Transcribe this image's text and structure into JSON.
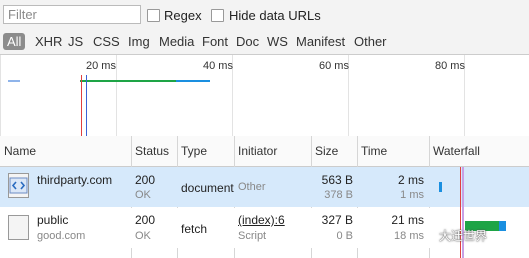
{
  "filterbar": {
    "filter_placeholder": "Filter",
    "regex_label": "Regex",
    "hide_data_urls_label": "Hide data URLs"
  },
  "type_filters": [
    "All",
    "XHR",
    "JS",
    "CSS",
    "Img",
    "Media",
    "Font",
    "Doc",
    "WS",
    "Manifest",
    "Other"
  ],
  "selected_type_filter": "All",
  "overview": {
    "ticks": [
      "20 ms",
      "40 ms",
      "60 ms",
      "80 ms"
    ]
  },
  "columns": [
    "Name",
    "Status",
    "Type",
    "Initiator",
    "Size",
    "Time",
    "Waterfall"
  ],
  "requests": [
    {
      "name": "thirdparty.com",
      "domain": "",
      "status": "200",
      "status_text": "OK",
      "type": "document",
      "initiator": "Other",
      "initiator_sub": "",
      "size": "563 B",
      "content_size": "378 B",
      "time": "2 ms",
      "latency": "1 ms",
      "icon": "document-icon"
    },
    {
      "name": "public",
      "domain": "good.com",
      "status": "200",
      "status_text": "OK",
      "type": "fetch",
      "initiator": "(index):6",
      "initiator_sub": "Script",
      "size": "327 B",
      "content_size": "0 B",
      "time": "21 ms",
      "latency": "18 ms",
      "icon": "blank-file-icon"
    }
  ],
  "colors": {
    "selected_row": "#d6e9fb",
    "waiting_bar": "#1ea446",
    "download_bar": "#1a8fe0",
    "load_line": "#e04040",
    "dom_line": "#3a62d7"
  },
  "watermark": "大迁世界"
}
